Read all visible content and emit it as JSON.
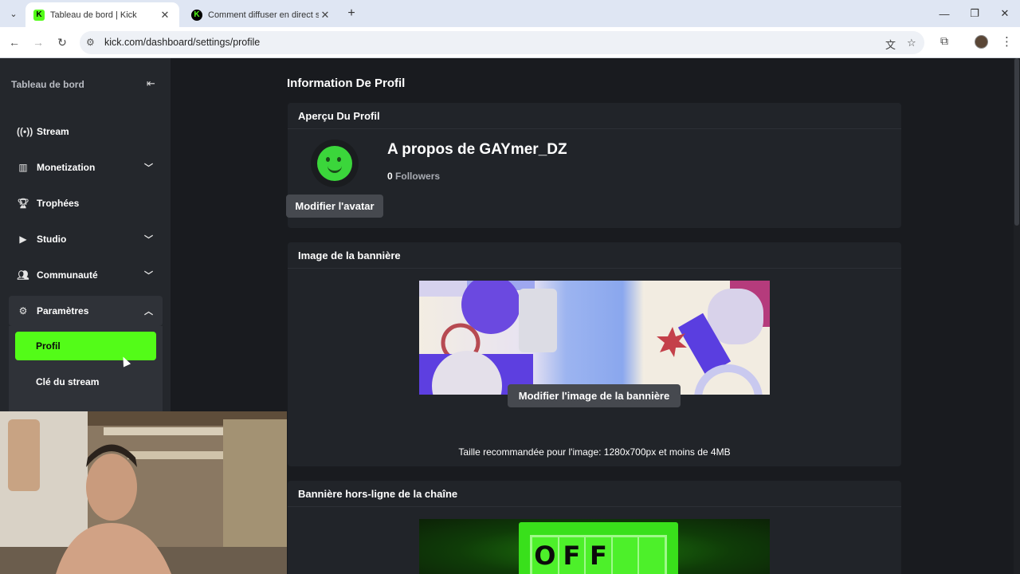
{
  "browser": {
    "tabs": [
      {
        "title": "Tableau de bord | Kick",
        "active": true,
        "favicon": "K"
      },
      {
        "title": "Comment diffuser en direct sur",
        "active": false,
        "favicon": "K"
      }
    ],
    "url": "kick.com/dashboard/settings/profile"
  },
  "sidebar": {
    "title": "Tableau de bord",
    "items": [
      {
        "label": "Stream",
        "icon": "broadcast-icon"
      },
      {
        "label": "Monetization",
        "icon": "chart-icon"
      },
      {
        "label": "Trophées",
        "icon": "trophy-icon"
      },
      {
        "label": "Studio",
        "icon": "play-square-icon"
      },
      {
        "label": "Communauté",
        "icon": "community-icon"
      },
      {
        "label": "Paramètres",
        "icon": "gear-icon"
      }
    ],
    "sub_items": [
      {
        "label": "Profil",
        "active": true
      },
      {
        "label": "Clé du stream",
        "active": false
      }
    ]
  },
  "main": {
    "title": "Information De Profil",
    "profile_preview": {
      "header": "Aperçu Du Profil",
      "about": "A propos de GAYmer_DZ",
      "followers_count": "0",
      "followers_label": "Followers",
      "edit_avatar_label": "Modifier l'avatar"
    },
    "banner": {
      "header": "Image de la bannière",
      "edit_label": "Modifier l'image de la bannière",
      "recommendation": "Taille recommandée pour l'image: 1280x700px et moins de 4MB"
    },
    "offline_banner": {
      "header": "Bannière hors-ligne de la chaîne",
      "sign_letters": [
        "O",
        "F",
        "F",
        "",
        ""
      ]
    }
  },
  "colors": {
    "accent": "#53fc18",
    "background": "#191b1f",
    "card": "#212429",
    "sidebar": "#24272c"
  }
}
